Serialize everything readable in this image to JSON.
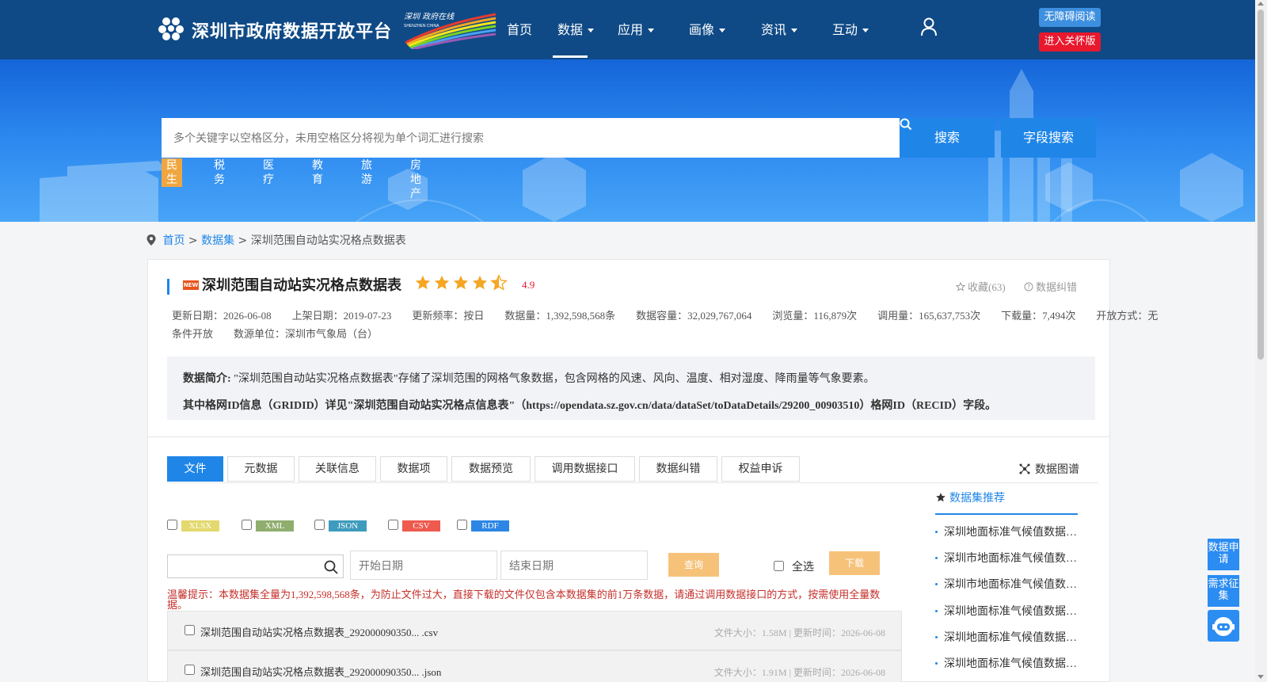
{
  "header": {
    "site_title": "深圳市政府数据开放平台",
    "badge_text": "深圳 政府在线 SHENZHEN CHINA",
    "nav": [
      {
        "label": "首页",
        "has_caret": false,
        "active": false
      },
      {
        "label": "数据",
        "has_caret": true,
        "active": true
      },
      {
        "label": "应用",
        "has_caret": true,
        "active": false
      },
      {
        "label": "画像",
        "has_caret": true,
        "active": false
      },
      {
        "label": "资讯",
        "has_caret": true,
        "active": false
      },
      {
        "label": "互动",
        "has_caret": true,
        "active": false
      }
    ],
    "accessibility_label": "无障碍阅读",
    "care_label": "进入关怀版"
  },
  "search": {
    "placeholder": "多个关键字以空格区分，未用空格区分将视为单个词汇进行搜索",
    "search_label": "搜索",
    "field_search_label": "字段搜索",
    "hot_tags": [
      "民生",
      "税务",
      "医疗",
      "教育",
      "旅游",
      "房地产"
    ]
  },
  "breadcrumb": {
    "home": "首页",
    "datasets": "数据集",
    "current": "深圳范围自动站实况格点数据表",
    "sep": ">"
  },
  "dataset": {
    "new_badge": "NEW",
    "title": "深圳范围自动站实况格点数据表",
    "rating": "4.9",
    "rating_value": 4.5,
    "favorite": "收藏(63)",
    "correction": "数据纠错",
    "meta_line1": "更新日期：2026-06-08　　上架日期：2019-07-23　　更新频率：按日　　数据量：1,392,598,568条　　数据容量：32,029,767,064　　浏览量：116,879次　　调用量：165,637,753次　　下载量：7,494次　　开放方式：无",
    "meta_line2": "条件开放　　数源单位：深圳市气象局（台）",
    "intro_label": "数据简介:",
    "intro_text": "\"深圳范围自动站实况格点数据表\"存储了深圳范围的网格气象数据，包含网格的风速、风向、温度、相对湿度、降雨量等气象要素。",
    "intro_text2": "其中格网ID信息（GRIDID）详见\"深圳范围自动站实况格点信息表\"（https://opendata.sz.gov.cn/data/dataSet/toDataDetails/29200_00903510）格网ID（RECID）字段。"
  },
  "tabs": [
    "文件",
    "元数据",
    "关联信息",
    "数据项",
    "数据预览",
    "调用数据接口",
    "数据纠错",
    "权益申诉"
  ],
  "graph_link": "数据图谱",
  "file_types": [
    {
      "label": "XLSX",
      "color": "#e3d96e"
    },
    {
      "label": "XML",
      "color": "#8fae6e"
    },
    {
      "label": "JSON",
      "color": "#3e9bbd"
    },
    {
      "label": "CSV",
      "color": "#ee5a4e"
    },
    {
      "label": "RDF",
      "color": "#2d86e5"
    }
  ],
  "query": {
    "start_date_placeholder": "开始日期",
    "end_date_placeholder": "结束日期",
    "query_label": "查询",
    "select_all_label": "全选",
    "download_label": "下载"
  },
  "warning": "温馨提示：本数据集全量为1,392,598,568条，为防止文件过大，直接下载的文件仅包含本数据集的前1万条数据，请通过调用数据接口的方式，按需使用全量数据。",
  "files": [
    {
      "name": "深圳范围自动站实况格点数据表_292000090350... .csv",
      "meta": "文件大小：1.58M | 更新时间：2026-06-08"
    },
    {
      "name": "深圳范围自动站实况格点数据表_292000090350... .json",
      "meta": "文件大小：1.91M | 更新时间：2026-06-08"
    }
  ],
  "recommend": {
    "title": "数据集推荐",
    "items": [
      "深圳地面标准气候值数据…",
      "深圳市地面标准气候值数…",
      "深圳市地面标准气候值数…",
      "深圳地面标准气候值数据…",
      "深圳地面标准气候值数据…",
      "深圳地面标准气候值数据…"
    ]
  },
  "float": {
    "apply": "数据申请",
    "demand": "需求征集"
  },
  "colors": {
    "header_bg": "#0f4a86",
    "accent": "#1f86e8",
    "warning": "#c4302b",
    "star": "#f5a623"
  }
}
